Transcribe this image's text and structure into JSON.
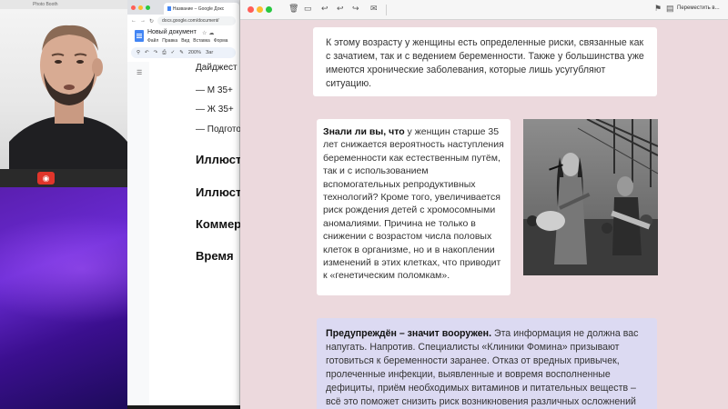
{
  "photobooth": {
    "title": "Photo Booth",
    "shutter_icon": "camera-icon"
  },
  "browser": {
    "tab_title": "Название – Google Докс",
    "url": "docs.google.com/document/",
    "doc_title": "Новый документ",
    "menu": [
      "Файл",
      "Правка",
      "Вид",
      "Вставка",
      "Форма"
    ],
    "zoom": "200%",
    "toolbar_trailing": "Заг",
    "doc_lines": [
      "Дайджест",
      "— М 35+",
      "— Ж 35+",
      "— Подгото"
    ],
    "doc_headings": [
      "Иллюст",
      "Иллюст",
      "Коммер",
      "Время"
    ]
  },
  "viewer": {
    "move_label": "Переместить в...",
    "colors": {
      "background": "#ecd9dd",
      "card": "#ffffff",
      "highlight_card": "#dcdaf2"
    },
    "card1_text": "К этому возрасту у женщины есть определенные риски, связанные как с зачатием, так и с ведением беременности. Также у большинства уже имеются хронические заболевания, которые лишь усугубляют ситуацию.",
    "card2_bold": "Знали ли вы, что",
    "card2_text": " у женщин старше 35 лет снижается вероятность наступления беременности как естественным путём, так и с использованием вспомогательных репродуктивных технологий? Кроме того, увеличивается риск рождения детей с хромосомными аномалиями. Причина не только в снижении с возрастом числа половых клеток в организме, но и в накоплении изменений в этих клетках, что приводит к «генетическим поломкам».",
    "card3_bold": "Предупреждён – значит вооружен.",
    "card3_text": " Эта информация не должна вас напугать. Напротив. Специалисты «Клиники Фомина» призывают готовиться к беременности заранее. Отказ от вредных привычек, пролеченные инфекции, выявленные и вовремя восполненные дефициты, приём необходимых витаминов и питательных веществ – всё это поможет снизить риск возникновения различных осложнений"
  }
}
